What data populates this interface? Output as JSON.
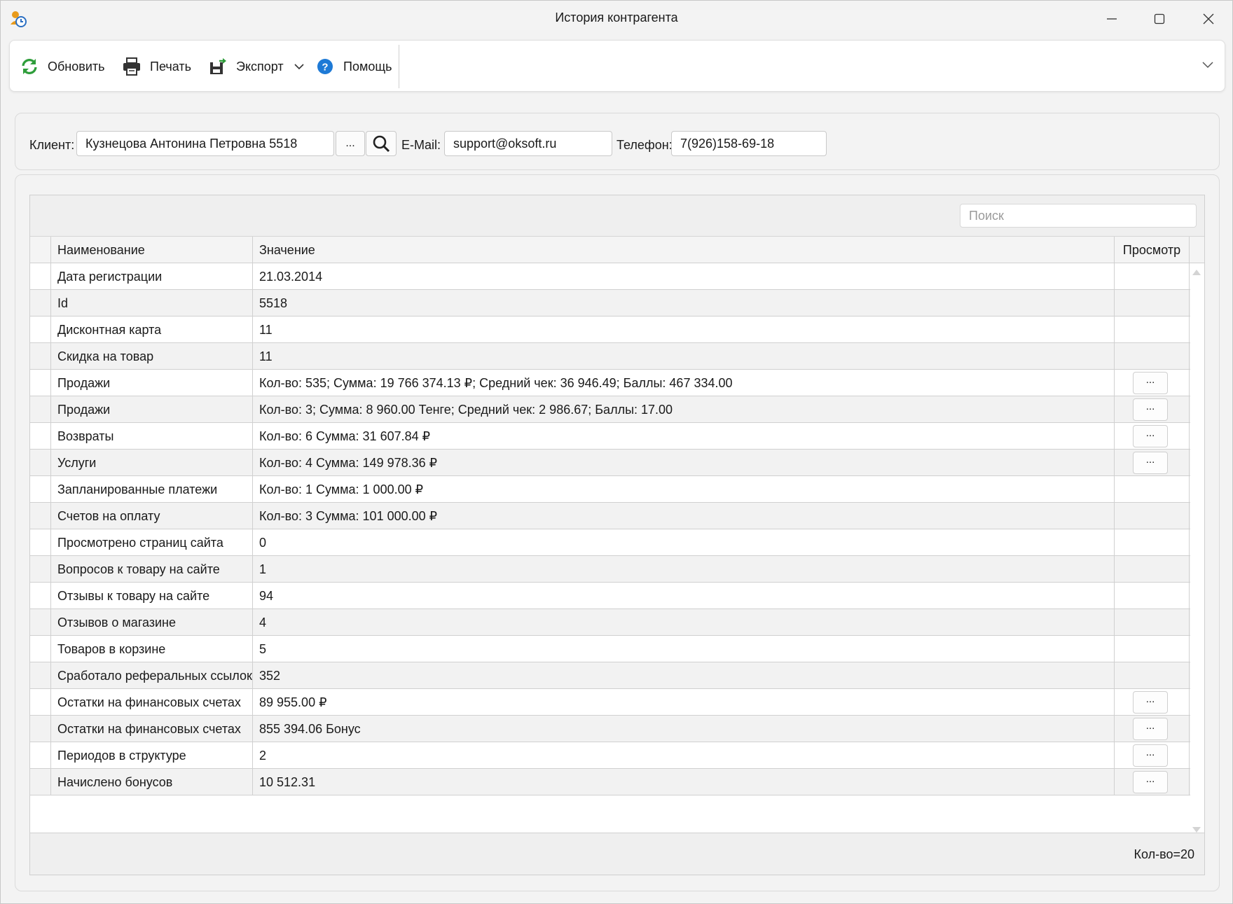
{
  "window": {
    "title": "История контрагента"
  },
  "toolbar": {
    "refresh_label": "Обновить",
    "print_label": "Печать",
    "export_label": "Экспорт",
    "help_label": "Помощь"
  },
  "filter": {
    "client_label": "Клиент:",
    "client_value": "Кузнецова Антонина Петровна 5518",
    "browse_label": "...",
    "email_label": "E-Mail:",
    "email_value": "support@oksoft.ru",
    "phone_label": "Телефон:",
    "phone_value": "7(926)158-69-18"
  },
  "grid": {
    "search_placeholder": "Поиск",
    "columns": [
      "Наименование",
      "Значение",
      "Просмотр"
    ],
    "view_label": "...",
    "rows": [
      {
        "name": "Дата регистрации",
        "value": "21.03.2014",
        "view": false
      },
      {
        "name": "Id",
        "value": "5518",
        "view": false
      },
      {
        "name": "Дисконтная карта",
        "value": "11",
        "view": false
      },
      {
        "name": "Скидка на товар",
        "value": "11",
        "view": false
      },
      {
        "name": "Продажи",
        "value": "Кол-во: 535; Сумма: 19 766 374.13 ₽; Средний чек: 36 946.49; Баллы: 467 334.00",
        "view": true
      },
      {
        "name": "Продажи",
        "value": "Кол-во: 3; Сумма: 8 960.00 Тенге; Средний чек: 2 986.67; Баллы: 17.00",
        "view": true
      },
      {
        "name": "Возвраты",
        "value": "Кол-во: 6 Сумма: 31 607.84 ₽",
        "view": true
      },
      {
        "name": "Услуги",
        "value": "Кол-во: 4 Сумма: 149 978.36 ₽",
        "view": true
      },
      {
        "name": "Запланированные платежи",
        "value": "Кол-во: 1 Сумма: 1 000.00 ₽",
        "view": false
      },
      {
        "name": "Счетов на оплату",
        "value": "Кол-во: 3 Сумма: 101 000.00 ₽",
        "view": false
      },
      {
        "name": "Просмотрено страниц сайта",
        "value": "0",
        "view": false
      },
      {
        "name": "Вопросов к товару на сайте",
        "value": "1",
        "view": false
      },
      {
        "name": "Отзывы к товару на сайте",
        "value": "94",
        "view": false
      },
      {
        "name": "Отзывов о магазине",
        "value": "4",
        "view": false
      },
      {
        "name": "Товаров в корзине",
        "value": "5",
        "view": false
      },
      {
        "name": "Сработало реферальных ссылок",
        "value": "352",
        "view": false
      },
      {
        "name": "Остатки на финансовых счетах",
        "value": "89 955.00 ₽",
        "view": true
      },
      {
        "name": "Остатки на финансовых счетах",
        "value": "855 394.06 Бонус",
        "view": true
      },
      {
        "name": "Периодов в структуре",
        "value": "2",
        "view": true
      },
      {
        "name": "Начислено бонусов",
        "value": "10 512.31",
        "view": true
      }
    ],
    "count_text": "Кол-во=20"
  },
  "colors": {
    "refresh_icon": "#2e9d3a",
    "help_icon": "#1e7ad6",
    "export_icon_accent": "#2e9d3a"
  },
  "icons": {
    "refresh": "refresh-icon",
    "print": "printer-icon",
    "export": "export-icon",
    "help": "help-icon",
    "search": "search-icon"
  }
}
